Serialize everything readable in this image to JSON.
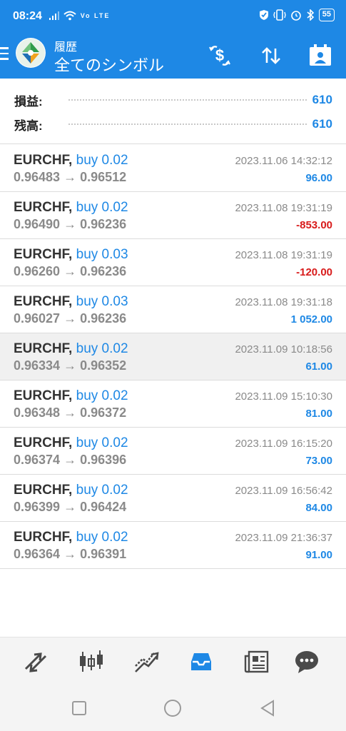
{
  "status_bar": {
    "time": "08:24",
    "network_label": "Vo LTE",
    "battery": "55",
    "left_icons": [
      "signal-icon",
      "wifi-icon"
    ],
    "right_icons": [
      "vpn-icon",
      "vibrate-icon",
      "alarm-icon",
      "bluetooth-icon",
      "battery-icon"
    ]
  },
  "app_bar": {
    "title": "履歴",
    "subtitle": "全てのシンボル",
    "actions": [
      "currency-exchange-icon",
      "sort-icon",
      "calendar-icon"
    ]
  },
  "summary": {
    "profit_label": "損益:",
    "profit_value": "610",
    "balance_label": "残高:",
    "balance_value": "610"
  },
  "deals": [
    {
      "symbol": "EURCHF,",
      "side": "buy 0.02",
      "open": "0.96483",
      "close": "0.96512",
      "time": "2023.11.06 14:32:12",
      "profit": "96.00",
      "profit_color": "#1e88e5"
    },
    {
      "symbol": "EURCHF,",
      "side": "buy 0.02",
      "open": "0.96490",
      "close": "0.96236",
      "time": "2023.11.08 19:31:19",
      "profit": "-853.00",
      "profit_color": "#d81b1b"
    },
    {
      "symbol": "EURCHF,",
      "side": "buy 0.03",
      "open": "0.96260",
      "close": "0.96236",
      "time": "2023.11.08 19:31:19",
      "profit": "-120.00",
      "profit_color": "#d81b1b"
    },
    {
      "symbol": "EURCHF,",
      "side": "buy 0.03",
      "open": "0.96027",
      "close": "0.96236",
      "time": "2023.11.08 19:31:18",
      "profit": "1 052.00",
      "profit_color": "#1e88e5"
    },
    {
      "symbol": "EURCHF,",
      "side": "buy 0.02",
      "open": "0.96334",
      "close": "0.96352",
      "time": "2023.11.09 10:18:56",
      "profit": "61.00",
      "profit_color": "#1e88e5"
    },
    {
      "symbol": "EURCHF,",
      "side": "buy 0.02",
      "open": "0.96348",
      "close": "0.96372",
      "time": "2023.11.09 15:10:30",
      "profit": "81.00",
      "profit_color": "#1e88e5"
    },
    {
      "symbol": "EURCHF,",
      "side": "buy 0.02",
      "open": "0.96374",
      "close": "0.96396",
      "time": "2023.11.09 16:15:20",
      "profit": "73.00",
      "profit_color": "#1e88e5"
    },
    {
      "symbol": "EURCHF,",
      "side": "buy 0.02",
      "open": "0.96399",
      "close": "0.96424",
      "time": "2023.11.09 16:56:42",
      "profit": "84.00",
      "profit_color": "#1e88e5"
    },
    {
      "symbol": "EURCHF,",
      "side": "buy 0.02",
      "open": "0.96364",
      "close": "0.96391",
      "time": "2023.11.09 21:36:37",
      "profit": "91.00",
      "profit_color": "#1e88e5"
    }
  ],
  "arrow": "→",
  "bottom_nav": [
    "quotes-icon",
    "chart-icon",
    "trade-icon",
    "history-icon",
    "news-icon",
    "chat-icon"
  ],
  "active_tab": "history-icon",
  "colors": {
    "accent": "#1e88e5",
    "loss": "#d81b1b",
    "nav_icon": "#4a4a4a"
  }
}
